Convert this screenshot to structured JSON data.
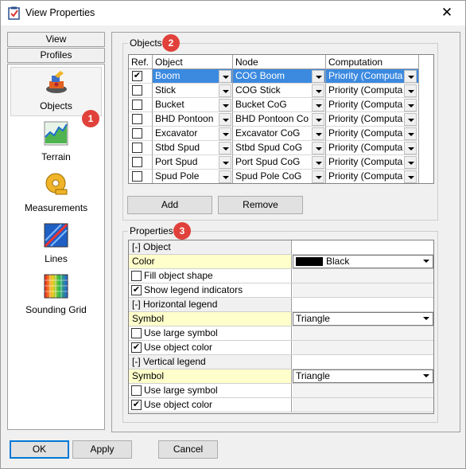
{
  "window": {
    "title": "View Properties",
    "close_glyph": "✕"
  },
  "nav": {
    "headers": [
      "View",
      "Profiles"
    ],
    "items": [
      {
        "label": "Objects",
        "icon": "objects-icon",
        "selected": true
      },
      {
        "label": "Terrain",
        "icon": "terrain-icon"
      },
      {
        "label": "Measurements",
        "icon": "measurements-icon"
      },
      {
        "label": "Lines",
        "icon": "lines-icon"
      },
      {
        "label": "Sounding Grid",
        "icon": "sounding-grid-icon"
      }
    ]
  },
  "callouts": [
    "1",
    "2",
    "3"
  ],
  "objects": {
    "group_label": "Objects",
    "columns": [
      "Ref.",
      "Object",
      "Node",
      "Computation"
    ],
    "rows": [
      {
        "ref": true,
        "object": "Boom",
        "node": "COG Boom",
        "computation": "Priority (Computa",
        "selected": true
      },
      {
        "ref": false,
        "object": "Stick",
        "node": "COG Stick",
        "computation": "Priority (Computa"
      },
      {
        "ref": false,
        "object": "Bucket",
        "node": "Bucket CoG",
        "computation": "Priority (Computa"
      },
      {
        "ref": false,
        "object": "BHD Pontoon",
        "node": "BHD Pontoon Co",
        "computation": "Priority (Computa"
      },
      {
        "ref": false,
        "object": "Excavator",
        "node": "Excavator CoG",
        "computation": "Priority (Computa"
      },
      {
        "ref": false,
        "object": "Stbd Spud",
        "node": "Stbd Spud CoG",
        "computation": "Priority (Computa"
      },
      {
        "ref": false,
        "object": "Port Spud",
        "node": "Port Spud CoG",
        "computation": "Priority (Computa"
      },
      {
        "ref": false,
        "object": "Spud Pole",
        "node": "Spud Pole CoG",
        "computation": "Priority (Computa"
      }
    ],
    "add_label": "Add",
    "remove_label": "Remove"
  },
  "properties": {
    "group_label": "Properties",
    "rows": [
      {
        "kind": "category",
        "label": "[-] Object"
      },
      {
        "kind": "combo",
        "label": "Color",
        "value": "Black",
        "swatch": "#000000"
      },
      {
        "kind": "check",
        "label": "Fill object shape",
        "checked": false
      },
      {
        "kind": "check",
        "label": "Show legend indicators",
        "checked": true
      },
      {
        "kind": "category",
        "label": "[-] Horizontal legend"
      },
      {
        "kind": "combo",
        "label": "Symbol",
        "value": "Triangle"
      },
      {
        "kind": "check",
        "label": "Use large symbol",
        "checked": false
      },
      {
        "kind": "check",
        "label": "Use object color",
        "checked": true
      },
      {
        "kind": "category",
        "label": "[-] Vertical legend"
      },
      {
        "kind": "combo",
        "label": "Symbol",
        "value": "Triangle"
      },
      {
        "kind": "check",
        "label": "Use large symbol",
        "checked": false
      },
      {
        "kind": "check",
        "label": "Use object color",
        "checked": true
      }
    ]
  },
  "footer": {
    "ok_label": "OK",
    "apply_label": "Apply",
    "cancel_label": "Cancel"
  },
  "colors": {
    "selection": "#3c8ae0",
    "property_name_bg": "#ffffcc",
    "callout": "#e0413a"
  }
}
